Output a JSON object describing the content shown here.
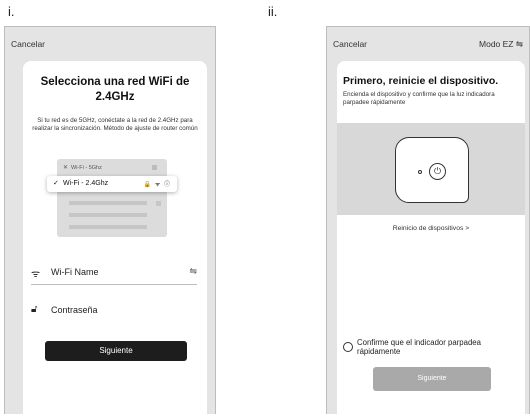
{
  "labels": {
    "panel_i": "i.",
    "panel_ii": "ii."
  },
  "screen1": {
    "cancel": "Cancelar",
    "title": "Selecciona una red WiFi de 2.4GHz",
    "description": "Si tu red es de 5GHz, conéctate a la red de 2.4GHz para realizar la sincronización. Método de ajuste de router común",
    "illustration": {
      "row_5ghz": "Wi-Fi - 5Ghz",
      "row_24ghz": "Wi-Fi - 2.4Ghz",
      "icons": "🔒 ᯤ ⓘ"
    },
    "wifi_name": "Wi-Fi Name",
    "password_placeholder": "Contraseña",
    "next": "Siguiente"
  },
  "screen2": {
    "cancel": "Cancelar",
    "mode": "Modo EZ ⇋",
    "title": "Primero, reinicie el dispositivo.",
    "description": "Encienda el dispositivo y confirme que la luz indicadora parpadee rápidamente",
    "reset_link": "Reinicio de dispositivos >",
    "confirm_text": "Confirme que el indicador parpadea rápidamente",
    "next": "Siguiente"
  }
}
